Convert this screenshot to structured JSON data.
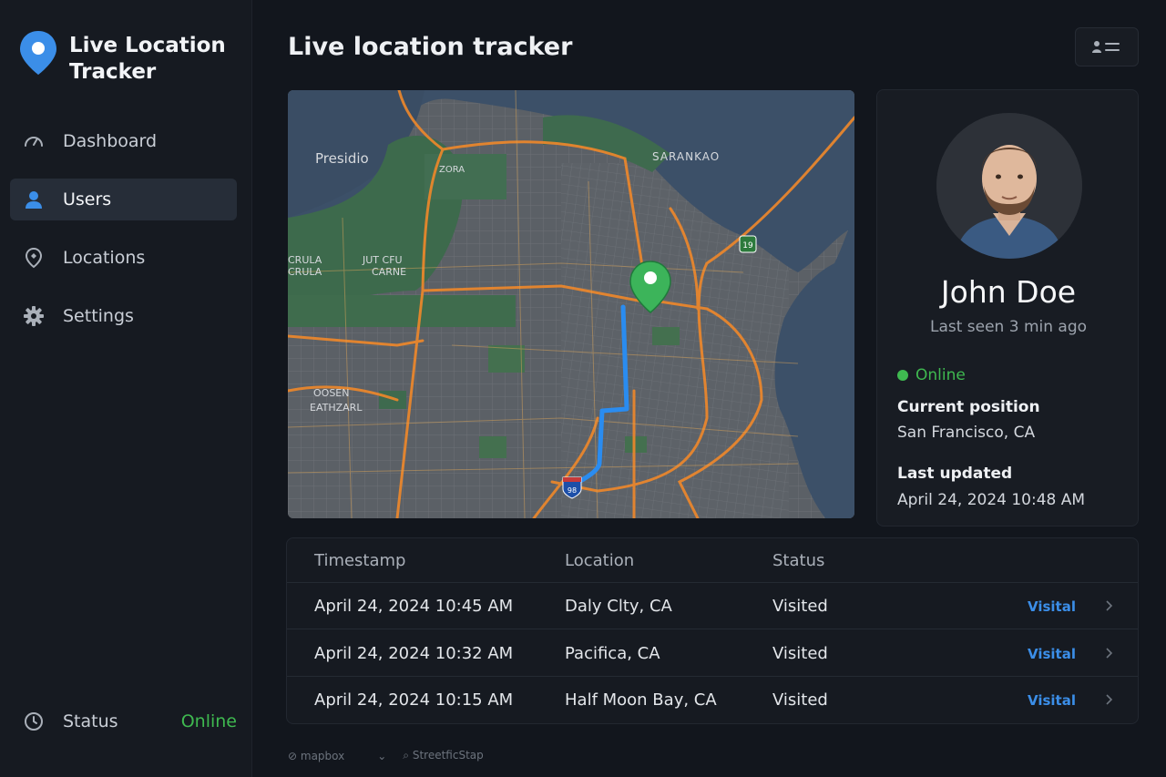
{
  "app": {
    "title": "Live Location Tracker"
  },
  "sidebar": {
    "items": [
      {
        "label": "Dashboard",
        "icon": "gauge-icon",
        "active": false
      },
      {
        "label": "Users",
        "icon": "user-icon",
        "active": true
      },
      {
        "label": "Locations",
        "icon": "location-pin-icon",
        "active": false
      },
      {
        "label": "Settings",
        "icon": "gear-icon",
        "active": false
      }
    ],
    "status": {
      "label": "Status",
      "value": "Online",
      "icon": "clock-icon"
    }
  },
  "header": {
    "title": "Live location tracker",
    "menu_icon": "user-list-icon"
  },
  "map": {
    "labels": {
      "presidio": "Presidio",
      "saranka": "SARANKA⁠O",
      "zora": "ZORA",
      "jut_carne": "JUT CFU",
      "carne": "CARNE",
      "crula": "CRULA",
      "rula2": "CRULA",
      "oosen": "OOSEN",
      "eathzarl": "EATHZARL",
      "shield_19": "19",
      "shield_98": "98"
    },
    "marker_color": "#3cb45a",
    "route_color": "#2a8cf0"
  },
  "profile": {
    "name": "John Doe",
    "last_seen": "Last seen 3 min ago",
    "status": "Online",
    "position_label": "Current position",
    "position_value": "San Francisco, CA",
    "updated_label": "Last updated",
    "updated_value": "April 24, 2024 10:48 AM"
  },
  "table": {
    "headers": [
      "Timestamp",
      "Location",
      "Status"
    ],
    "rows": [
      {
        "timestamp": "April 24, 2024 10:45 AM",
        "location": "Daly Clty, CA",
        "status": "Visited",
        "link": "Visital"
      },
      {
        "timestamp": "April 24, 2024 10:32 AM",
        "location": "Pacifica, CA",
        "status": "Visited",
        "link": "Visital"
      },
      {
        "timestamp": "April 24, 2024 10:15 AM",
        "location": "Half Moon Bay, CA",
        "status": "Visited",
        "link": "Visital"
      }
    ]
  },
  "footer": {
    "mapbox": "mapbox",
    "separator": "⌄",
    "street": "StreetficStap"
  },
  "colors": {
    "accent": "#3b8ee8",
    "online": "#3fb950",
    "background": "#12161d"
  }
}
